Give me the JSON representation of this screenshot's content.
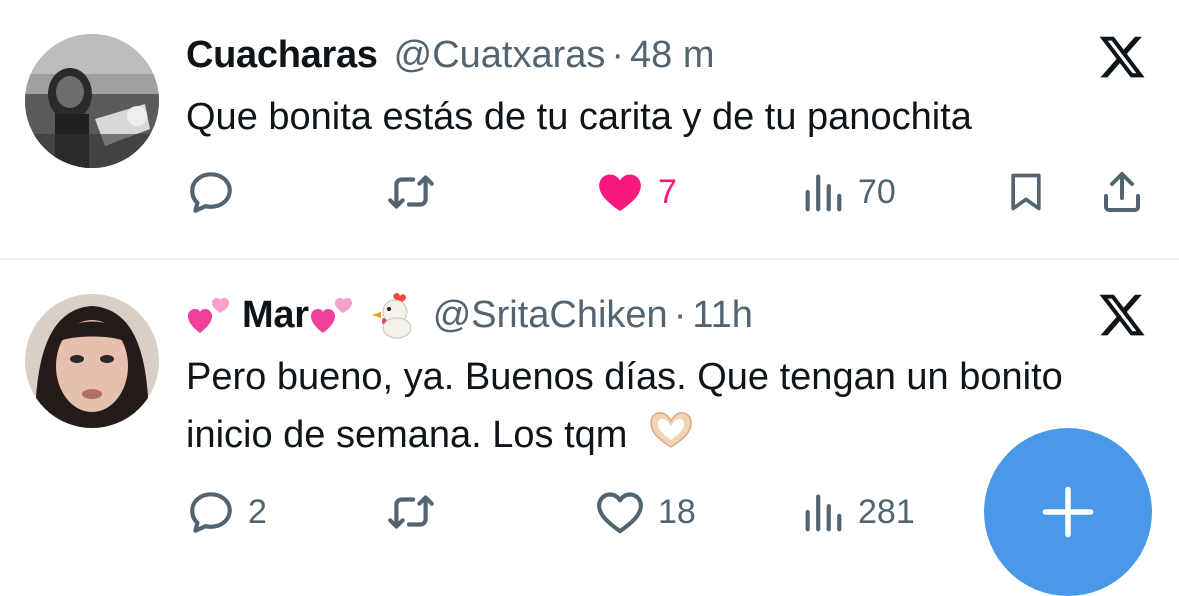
{
  "tweets": [
    {
      "display_name": "Cuacharas",
      "handle": "@Cuatxaras",
      "separator": "·",
      "time": "48 m",
      "text": "Que bonita estás de tu carita y de tu panochita",
      "replies": "",
      "retweets": "",
      "likes": "7",
      "liked": true,
      "views": "70"
    },
    {
      "display_name": "Mar",
      "handle": "@SritaChiken",
      "separator": "·",
      "time": "11h",
      "text": "Pero bueno, ya. Buenos días. Que tengan un bonito inicio de semana. Los tqm",
      "replies": "2",
      "retweets": "",
      "likes": "18",
      "liked": false,
      "views": "281"
    }
  ],
  "icons": {
    "x_logo": "x-logo-icon",
    "reply": "reply-icon",
    "retweet": "retweet-icon",
    "like": "heart-icon",
    "views": "views-icon",
    "bookmark": "bookmark-icon",
    "share": "share-icon",
    "compose": "plus-icon"
  },
  "colors": {
    "text": "#0f1419",
    "secondary": "#536471",
    "like_active": "#f91880",
    "fab": "#4a99e9",
    "divider": "#eff3f4"
  }
}
